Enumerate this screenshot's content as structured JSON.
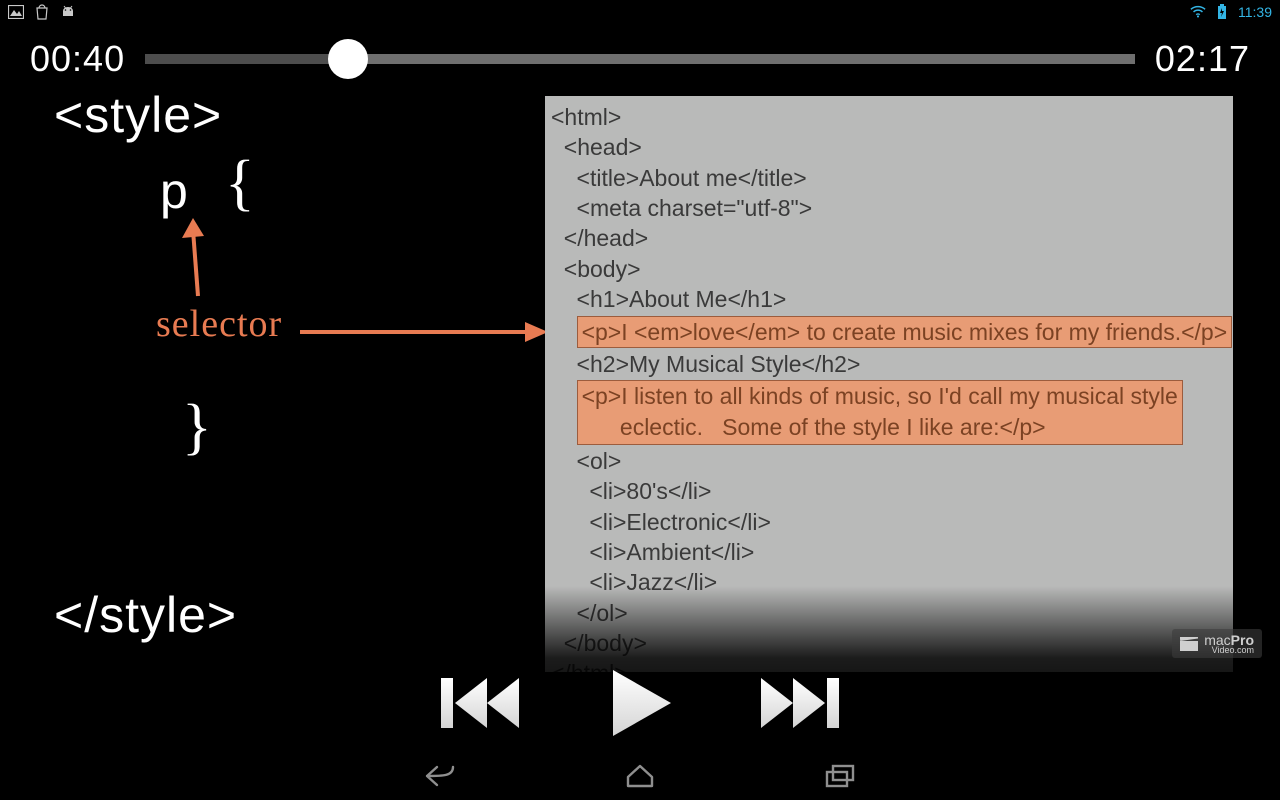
{
  "status": {
    "clock": "11:39"
  },
  "player": {
    "current": "00:40",
    "total": "02:17",
    "progress_pct": 20.5
  },
  "slide": {
    "style_open": "<style>",
    "selector": "p",
    "brace_open": "{",
    "brace_close": "}",
    "style_close": "</style>",
    "selector_label": "selector"
  },
  "code": {
    "l1": "<html>",
    "l2": "  <head>",
    "l3": "    <title>About me</title>",
    "l4": "    <meta charset=\"utf-8\">",
    "l5": "  </head>",
    "l6": "  <body>",
    "l7": "    <h1>About Me</h1>",
    "l8p": "    ",
    "l8": "<p>I <em>love</em> to create music mixes for my friends.</p>",
    "l9": "    <h2>My Musical Style</h2>",
    "l10p": "    ",
    "l10a": "<p>I listen to all kinds of music, so I'd call my musical style",
    "l10b": "      eclectic.   Some of the style I like are:</p>",
    "l11": "    <ol>",
    "l12": "      <li>80's</li>",
    "l13": "      <li>Electronic</li>",
    "l14": "      <li>Ambient</li>",
    "l15": "      <li>Jazz</li>",
    "l16": "    </ol>",
    "l17": "  </body>",
    "l18": "</html>"
  },
  "watermark": {
    "brand_a": "mac",
    "brand_b": "Pro",
    "sub": "Video.com"
  }
}
